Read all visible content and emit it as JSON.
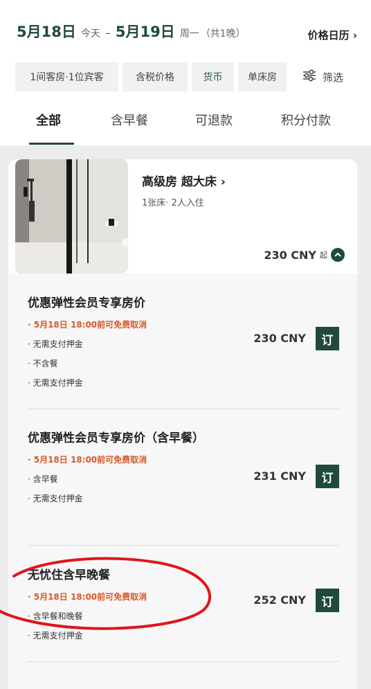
{
  "header": {
    "checkin_date": "5月18日",
    "checkin_day": "今天",
    "separator": "–",
    "checkout_date": "5月19日",
    "checkout_day": "周一",
    "nights": "（共1晚）",
    "calendar_link": "价格日历 ›"
  },
  "filters": {
    "chips": [
      "1间客房·1位宾客",
      "含税价格",
      "货币",
      "单床房"
    ],
    "filter_label": "筛选"
  },
  "tabs": [
    "全部",
    "含早餐",
    "可退款",
    "积分付款"
  ],
  "room": {
    "name": "高级房 超大床 ›",
    "meta": "1张床· 2人入住",
    "from_price": "230 CNY",
    "from_suffix": "起"
  },
  "rates": [
    {
      "title": "优惠弹性会员专享房价",
      "cancel": "· 5月18日 18:00前可免费取消",
      "features": [
        "· 无需支付押金",
        "· 不含餐",
        "· 无需支付押金"
      ],
      "price": "230 CNY",
      "book": "订"
    },
    {
      "title": "优惠弹性会员专享房价（含早餐）",
      "cancel": "· 5月18日 18:00前可免费取消",
      "features": [
        "· 含早餐",
        "· 无需支付押金"
      ],
      "price": "231 CNY",
      "book": "订"
    },
    {
      "title": "无忧住含早晚餐",
      "cancel": "· 5月18日 18:00前可免费取消",
      "features": [
        "· 含早餐和晚餐",
        "· 无需支付押金"
      ],
      "price": "252 CNY",
      "book": "订"
    }
  ],
  "colors": {
    "brand_green": "#1f4a3d",
    "cancel_red": "#d8572a",
    "annotation_red": "#e0151b"
  },
  "icons": [
    "sliders-icon",
    "chevron-up-icon"
  ]
}
